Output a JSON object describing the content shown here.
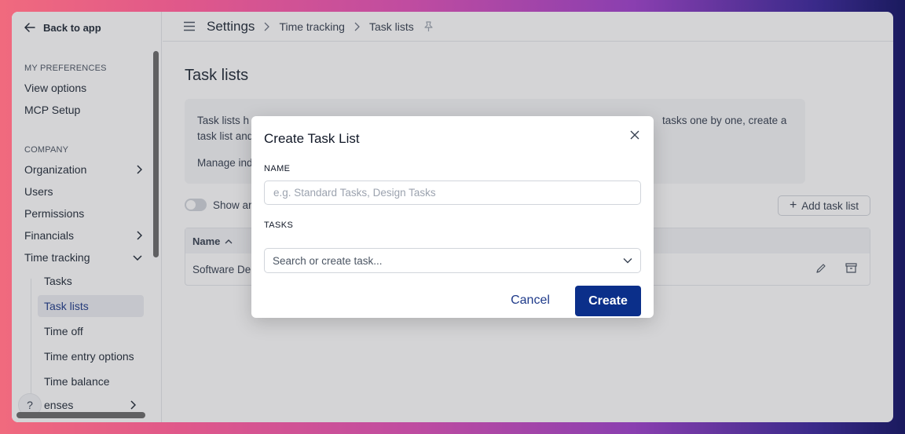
{
  "sidebar": {
    "back_label": "Back to app",
    "sections": [
      {
        "heading": "MY PREFERENCES"
      },
      {
        "heading": "COMPANY"
      }
    ],
    "preferences": [
      "View options",
      "MCP Setup"
    ],
    "company": {
      "organization": "Organization",
      "users": "Users",
      "permissions": "Permissions",
      "financials": "Financials",
      "time_tracking": "Time tracking",
      "expenses_partial": "enses"
    },
    "time_tracking_items": [
      "Tasks",
      "Task lists",
      "Time off",
      "Time entry options",
      "Time balance"
    ],
    "help": "?"
  },
  "header": {
    "root": "Settings",
    "crumbs": [
      "Time tracking",
      "Task lists"
    ]
  },
  "page": {
    "title": "Task lists",
    "info_line1": "Task lists h",
    "info_line1_end": "tasks one by one, create a",
    "info_line2": "task list and",
    "info_manage": "Manage ind",
    "show_archived": "Show ar",
    "add_button": "Add task list",
    "table": {
      "col_name": "Name",
      "rows": [
        {
          "name": "Software De"
        }
      ]
    }
  },
  "modal": {
    "title": "Create Task List",
    "name_label": "NAME",
    "name_placeholder": "e.g. Standard Tasks, Design Tasks",
    "tasks_label": "TASKS",
    "tasks_placeholder": "Search or create task...",
    "cancel": "Cancel",
    "create": "Create"
  },
  "colors": {
    "primary": "#0b2f8a",
    "active_nav_bg": "#eceef2",
    "active_nav_text": "#1e3a8a"
  }
}
